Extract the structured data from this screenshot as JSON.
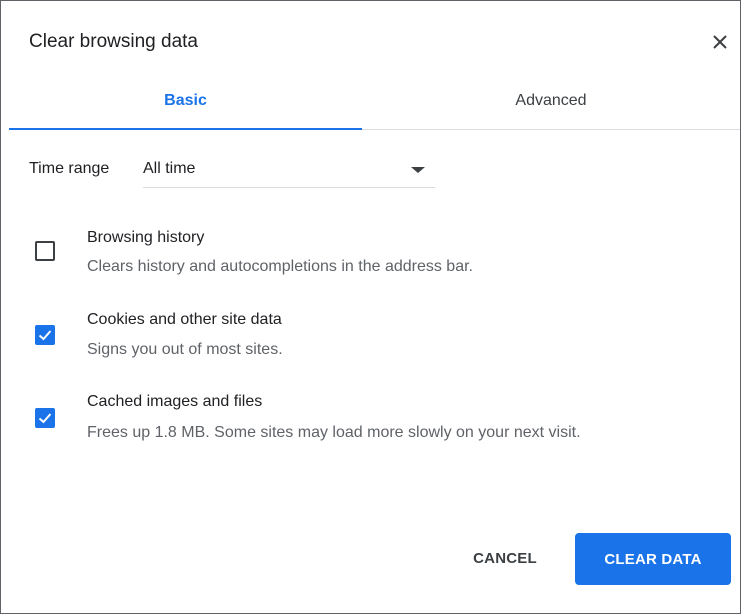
{
  "dialog": {
    "title": "Clear browsing data",
    "close_icon": "close-icon"
  },
  "tabs": [
    {
      "label": "Basic",
      "active": true
    },
    {
      "label": "Advanced",
      "active": false
    }
  ],
  "time_range": {
    "label": "Time range",
    "value": "All time"
  },
  "items": [
    {
      "title": "Browsing history",
      "description": "Clears history and autocompletions in the address bar.",
      "checked": false
    },
    {
      "title": "Cookies and other site data",
      "description": "Signs you out of most sites.",
      "checked": true
    },
    {
      "title": "Cached images and files",
      "description": "Frees up 1.8 MB. Some sites may load more slowly on your next visit.",
      "checked": true
    }
  ],
  "actions": {
    "cancel_label": "CANCEL",
    "clear_label": "CLEAR DATA"
  },
  "colors": {
    "accent": "#1a73e8",
    "text_primary": "#202124",
    "text_secondary": "#5f6368"
  }
}
